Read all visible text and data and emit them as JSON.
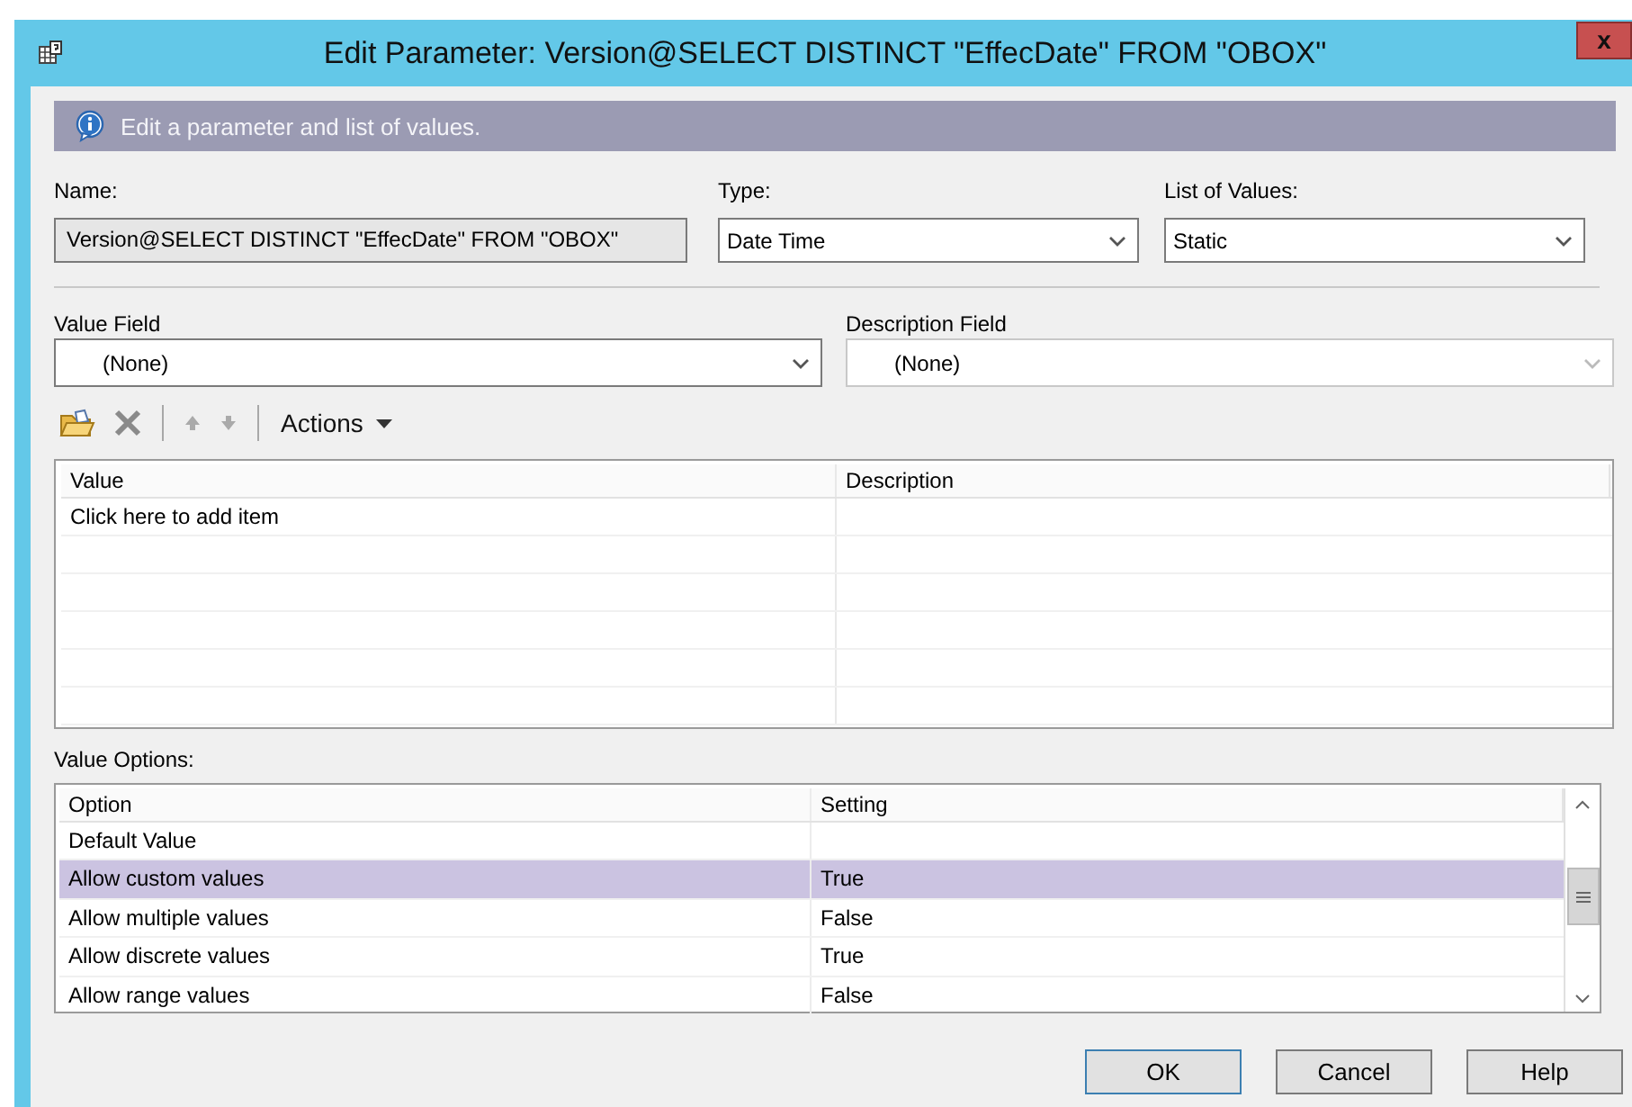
{
  "window": {
    "title": "Edit Parameter: Version@SELECT DISTINCT \"EffecDate\" FROM \"OBOX\"",
    "close": "x"
  },
  "info": "Edit a parameter and list of values.",
  "name": {
    "label": "Name:",
    "value": "Version@SELECT DISTINCT \"EffecDate\" FROM \"OBOX\"",
    "disabled": true
  },
  "type": {
    "label": "Type:",
    "value": "Date Time"
  },
  "list_of_values": {
    "label": "List of Values:",
    "value": "Static"
  },
  "value_field": {
    "label": "Value Field",
    "value": "(None)",
    "disabled": false
  },
  "description_field": {
    "label": "Description Field",
    "value": "(None)",
    "disabled": true
  },
  "toolbar": {
    "actions": "Actions"
  },
  "values_table": {
    "columns": [
      "Value",
      "Description"
    ],
    "rows": [
      [
        "Click here to add item",
        ""
      ]
    ]
  },
  "value_options": {
    "label": "Value Options:",
    "columns": [
      "Option",
      "Setting"
    ],
    "rows": [
      {
        "option": "Default Value",
        "setting": "",
        "selected": false
      },
      {
        "option": "Allow custom values",
        "setting": "True",
        "selected": true
      },
      {
        "option": "Allow multiple values",
        "setting": "False",
        "selected": false
      },
      {
        "option": "Allow discrete values",
        "setting": "True",
        "selected": false
      },
      {
        "option": "Allow range values",
        "setting": "False",
        "selected": false
      }
    ]
  },
  "buttons": [
    {
      "label": "OK",
      "default": true
    },
    {
      "label": "Cancel",
      "default": false
    },
    {
      "label": "Help",
      "default": false
    }
  ]
}
